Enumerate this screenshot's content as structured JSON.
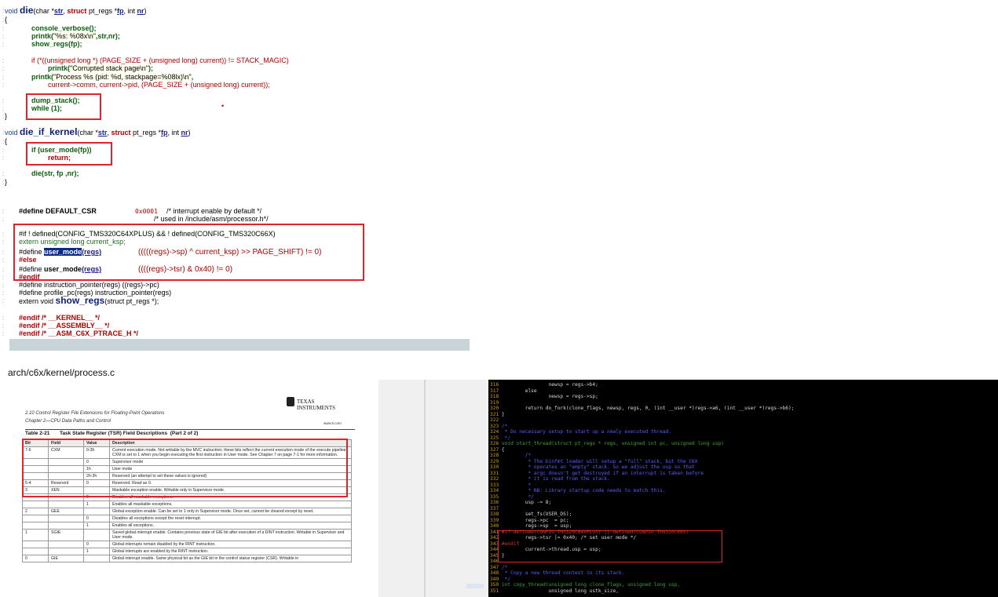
{
  "code_panel": {
    "die_sig": {
      "kw": "void",
      "name": "die",
      "p1a": "(char *",
      "p1": "str",
      "p2a": ", ",
      "p2k": "struct",
      "p2b": " pt_regs *",
      "p2": "fp",
      "p3a": ", int ",
      "p3": "nr",
      ")": ")"
    },
    "brace_open": "{",
    "l_console": "console_verbose();",
    "l_printk1a": "printk(",
    "l_printk1s": "\"%s: %08x\\n\"",
    "l_printk1b": ",str,nr);",
    "l_show": "show_regs(fp);",
    "l_if_a": "if (*((unsigned long *) (PAGE_SIZE + (unsigned long) current)) != STACK_MAGIC)",
    "l_printk2a": "printk(",
    "l_printk2s": "\"Corrupted stack page\\n\"",
    "l_printk2b": ");",
    "l_printk3a": "printk(",
    "l_printk3s": "\"Process %s (pid: %d, stackpage=%08lx)\\n\"",
    "l_printk3b": ",",
    "l_current": "current->comm, current->pid, (PAGE_SIZE + (unsigned long) current));",
    "l_dump": "dump_stack();",
    "l_while": "while (1);",
    "brace_close": "}",
    "die_if_sig": {
      "kw": "void",
      "name": "die_if_kernel",
      "p1a": "(char *",
      "p1": "str",
      "p2a": ", ",
      "p2k": "struct",
      "p2b": " pt_regs *",
      "p2": "fp",
      "p3a": ", int ",
      "p3": "nr",
      ")": ")"
    },
    "l_if_user": "if (user_mode(fp))",
    "l_return": "return;",
    "l_die_call": "die(str, fp ,nr);",
    "l_define_csr": "#define DEFAULT_CSR",
    "l_csr_val": "0x0001",
    "l_csr_c1": "/* interrupt enable by default */",
    "l_csr_c2": "/* used in /include/asm/processor.h*/",
    "l_ifdef": "#if ! defined(CONFIG_TMS320C64XPLUS) && ! defined(CONFIG_TMS320C66X)",
    "l_extern_ksp": "extern unsigned long current_ksp;",
    "l_def_um1a": "#define ",
    "l_def_um1": "user_mode",
    "l_def_um1b": "(regs)",
    "l_def_um1_body": "(((((regs)->sp) ^ current_ksp) >> PAGE_SHIFT) != 0)",
    "l_else": "#else",
    "l_def_um2a": "#define ",
    "l_def_um2": "user_mode",
    "l_def_um2b": "(regs)",
    "l_def_um2_body": "((((regs)->tsr) & 0x40) != 0)",
    "l_endif": "#endif",
    "l_ip": "#define instruction_pointer(regs) ((regs)->pc)",
    "l_ppc": "#define profile_pc(regs) instruction_pointer(regs)",
    "l_extern_show": "extern void ",
    "l_show_regs": "show_regs",
    "l_show_args": "(struct pt_regs *);",
    "l_end1": "#endif /* __KERNEL__ */",
    "l_end2": "#endif /* __ASSEMBLY__ */",
    "l_end3": "#endif /* __ASM_C6X_PTRACE_H */",
    "gutter": [
      ":",
      ":",
      ":",
      ":",
      ":",
      ":",
      ":",
      ":",
      ":",
      ":",
      ":",
      ":",
      ":",
      ":",
      ":",
      ":",
      ":",
      ":",
      ":",
      ":",
      ":",
      ":",
      ":",
      ":",
      ":",
      ":",
      ":",
      ":",
      ":",
      ":",
      ":",
      ":",
      ":",
      ":",
      ":",
      ":",
      ":"
    ]
  },
  "caption": "arch/c6x/kernel/process.c",
  "pdf": {
    "section": "2.10  Control Register File Extensions for Floating-Point Operations",
    "chapter": "Chapter 2—CPU Data Paths and Control",
    "brand": "TEXAS INSTRUMENTS",
    "url": "www.ti.com",
    "table_title": "Table 2-21       Task State Register (TSR) Field Descriptions  (Part 2 of 2)",
    "headers": [
      "Bit",
      "Field",
      "Value",
      "Description"
    ],
    "rows": [
      [
        "7-6",
        "CXM",
        "0-3h",
        "Current execution mode. Not writable by the MVC instruction; these bits reflect the current execution mode of the execute pipeline. CXM is set to 1 when you begin executing the first instruction in User mode. See Chapter 7 on page 7-1 for more information."
      ],
      [
        "",
        "",
        "0",
        "Supervisor mode"
      ],
      [
        "",
        "",
        "1h",
        "User mode"
      ],
      [
        "",
        "",
        "2h-3h",
        "Reserved (an attempt to set these values is ignored)"
      ],
      [
        "5-4",
        "Reserved",
        "0",
        "Reserved. Read as 0."
      ],
      [
        "3",
        "XEN",
        "",
        "Maskable exception enable. Writable only in Supervisor mode."
      ],
      [
        "",
        "",
        "0",
        "Disables all maskable exceptions."
      ],
      [
        "",
        "",
        "1",
        "Enables all maskable exceptions."
      ],
      [
        "2",
        "GEE",
        "",
        "Global exception enable. Can be set to 1 only in Supervisor mode. Once set, cannot be cleared except by reset."
      ],
      [
        "",
        "",
        "0",
        "Disables all exceptions except the reset interrupt."
      ],
      [
        "",
        "",
        "1",
        "Enables all exceptions."
      ],
      [
        "1",
        "SGIE",
        "",
        "Saved global interrupt enable. Contains previous state of GIE bit after execution of a DINT instruction. Writable in Supervisor and User mode."
      ],
      [
        "",
        "",
        "0",
        "Global interrupts remain disabled by the RINT instruction."
      ],
      [
        "",
        "",
        "1",
        "Global interrupts are enabled by the RINT instruction."
      ],
      [
        "0",
        "GIE",
        "",
        "Global interrupt enable. Same physical bit as the GIE bit in the control status register (CSR). Writable in"
      ]
    ]
  },
  "terminal": {
    "lines": [
      {
        "n": "316",
        "t": "                newsp = regs->b4;"
      },
      {
        "n": "317",
        "t": "        else"
      },
      {
        "n": "318",
        "t": "                newsp = regs->sp;"
      },
      {
        "n": "319",
        "t": ""
      },
      {
        "n": "320",
        "t": "        return do_fork(clone_flags, newsp, regs, 0, (int __user *)regs->a6, (int __user *)regs->b6);"
      },
      {
        "n": "321",
        "t": "}"
      },
      {
        "n": "322",
        "t": ""
      },
      {
        "n": "323",
        "t": "/*"
      },
      {
        "n": "324",
        "t": " * Do necessary setup to start up a newly executed thread."
      },
      {
        "n": "325",
        "t": " */"
      },
      {
        "n": "326",
        "t": "void start_thread(struct pt_regs * regs, unsigned int pc, unsigned long usp)"
      },
      {
        "n": "327",
        "t": "{"
      },
      {
        "n": "328",
        "t": "        /*"
      },
      {
        "n": "329",
        "t": "         * The binfmt loader will setup a \"full\" stack, but the C6X"
      },
      {
        "n": "330",
        "t": "         * operates an \"empty\" stack. So we adjust the usp so that"
      },
      {
        "n": "331",
        "t": "         * argc doesn't get destroyed if an interrupt is taken before"
      },
      {
        "n": "332",
        "t": "         * it is read from the stack."
      },
      {
        "n": "333",
        "t": "         *"
      },
      {
        "n": "334",
        "t": "         * NB: Library startup code needs to match this."
      },
      {
        "n": "335",
        "t": "         */"
      },
      {
        "n": "336",
        "t": "        usp -= 8;"
      },
      {
        "n": "337",
        "t": ""
      },
      {
        "n": "338",
        "t": "        set_fs(USER_DS);"
      },
      {
        "n": "339",
        "t": "        regs->pc  = pc;"
      },
      {
        "n": "340",
        "t": "        regs->sp  = usp;"
      },
      {
        "n": "341",
        "t": "#if defined(CONFIG_TMS320C64XPLUS) || defined(CONFIG_TMS320C66X)"
      },
      {
        "n": "342",
        "t": "        regs->tsr |= 0x40; /* set user mode */"
      },
      {
        "n": "343",
        "t": "#endif"
      },
      {
        "n": "344",
        "t": "        current->thread.usp = usp;"
      },
      {
        "n": "345",
        "t": "}"
      },
      {
        "n": "346",
        "t": ""
      },
      {
        "n": "347",
        "t": "/*"
      },
      {
        "n": "348",
        "t": " * Copy a new thread context in its stack."
      },
      {
        "n": "349",
        "t": " */"
      },
      {
        "n": "350",
        "t": "int copy_thread(unsigned long clone_flags, unsigned long usp,"
      },
      {
        "n": "351",
        "t": "                unsigned long ustk_size,"
      }
    ]
  },
  "colors": {
    "highlight_box": "#e0242e",
    "terminal_bg": "#000000",
    "scrollbar": "#c8d4d8"
  }
}
